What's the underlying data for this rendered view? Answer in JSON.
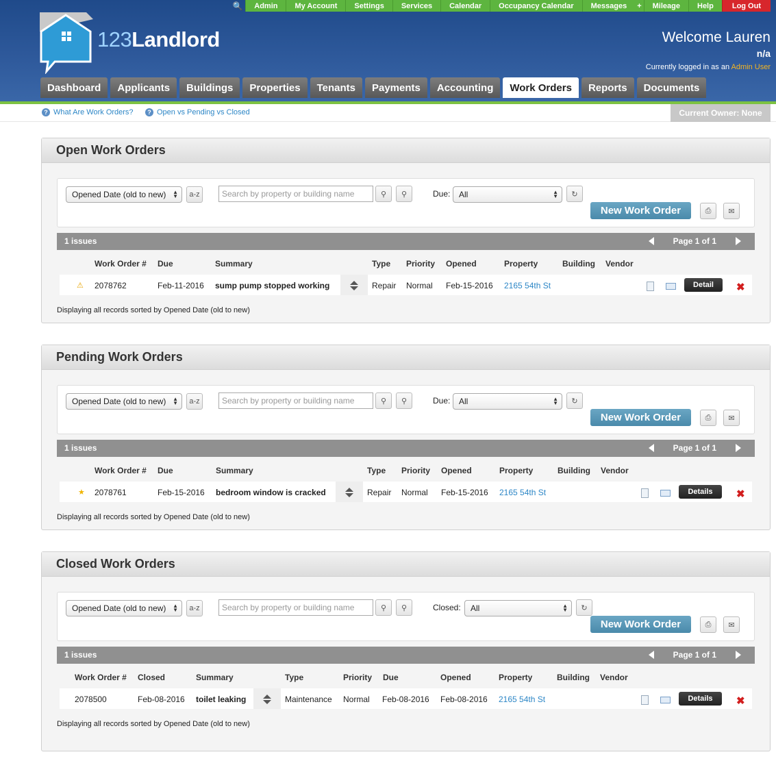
{
  "topnav": {
    "items": [
      "Admin",
      "My Account",
      "Settings",
      "Services",
      "Calendar",
      "Occupancy Calendar",
      "Messages",
      "+",
      "Mileage",
      "Help"
    ],
    "logout": "Log Out"
  },
  "logo": {
    "num": "123",
    "word": "Landlord"
  },
  "welcome": {
    "line1": "Welcome Lauren",
    "line2": "n/a",
    "line3_prefix": "Currently logged in as an ",
    "role": "Admin User"
  },
  "maintabs": [
    "Dashboard",
    "Applicants",
    "Buildings",
    "Properties",
    "Tenants",
    "Payments",
    "Accounting",
    "Work Orders",
    "Reports",
    "Documents"
  ],
  "active_tab": "Work Orders",
  "helplinks": [
    "What Are Work Orders?",
    "Open vs Pending vs Closed"
  ],
  "owner": "Current Owner: None",
  "common": {
    "sort_select": "Opened Date (old to new)",
    "search_placeholder": "Search by property or building name",
    "new_wo": "New Work Order",
    "page": "Page 1 of 1",
    "footnote": "Displaying all records sorted by Opened Date (old to new)",
    "az": "a-z"
  },
  "open": {
    "title": "Open Work Orders",
    "filter_label": "Due:",
    "filter_value": "All",
    "issues": "1 issues",
    "headers": [
      "Work Order #",
      "Due",
      "Summary",
      "Type",
      "Priority",
      "Opened",
      "Property",
      "Building",
      "Vendor"
    ],
    "row": {
      "wo": "2078762",
      "due": "Feb-11-2016",
      "summary": "sump pump stopped working",
      "type": "Repair",
      "priority": "Normal",
      "opened": "Feb-15-2016",
      "property": "2165 54th St",
      "detail": "Detail"
    }
  },
  "pending": {
    "title": "Pending Work Orders",
    "filter_label": "Due:",
    "filter_value": "All",
    "issues": "1 issues",
    "headers": [
      "Work Order #",
      "Due",
      "Summary",
      "Type",
      "Priority",
      "Opened",
      "Property",
      "Building",
      "Vendor"
    ],
    "row": {
      "wo": "2078761",
      "due": "Feb-15-2016",
      "summary": "bedroom window is cracked",
      "type": "Repair",
      "priority": "Normal",
      "opened": "Feb-15-2016",
      "property": "2165 54th St",
      "detail": "Details"
    }
  },
  "closed": {
    "title": "Closed Work Orders",
    "filter_label": "Closed:",
    "filter_value": "All",
    "issues": "1 issues",
    "headers": [
      "Work Order #",
      "Closed",
      "Summary",
      "Type",
      "Priority",
      "Due",
      "Opened",
      "Property",
      "Building",
      "Vendor"
    ],
    "row": {
      "wo": "2078500",
      "closed": "Feb-08-2016",
      "summary": "toilet leaking",
      "type": "Maintenance",
      "priority": "Normal",
      "due": "Feb-08-2016",
      "opened": "Feb-08-2016",
      "property": "2165 54th St",
      "detail": "Details"
    }
  }
}
